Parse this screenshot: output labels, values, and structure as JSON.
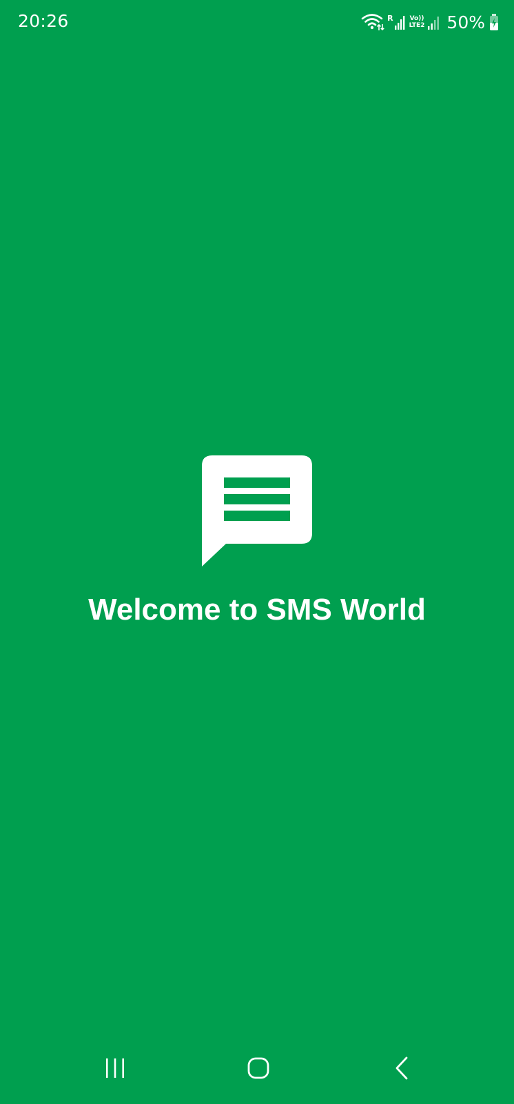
{
  "status_bar": {
    "time": "20:26",
    "icons": [
      "wifi-icon",
      "roaming-signal-icon",
      "volte-lte2-icon",
      "signal-icon",
      "battery-charging-icon"
    ],
    "roaming_letter": "R",
    "volte_label": "Vo))",
    "lte_label": "LTE2",
    "battery_percent": "50%"
  },
  "splash": {
    "logo_icon": "message-bubble-icon",
    "title": "Welcome to SMS World",
    "background_color": "#009f4f",
    "foreground_color": "#ffffff"
  },
  "nav_bar": {
    "buttons": [
      "recents-icon",
      "home-icon",
      "back-icon"
    ]
  }
}
